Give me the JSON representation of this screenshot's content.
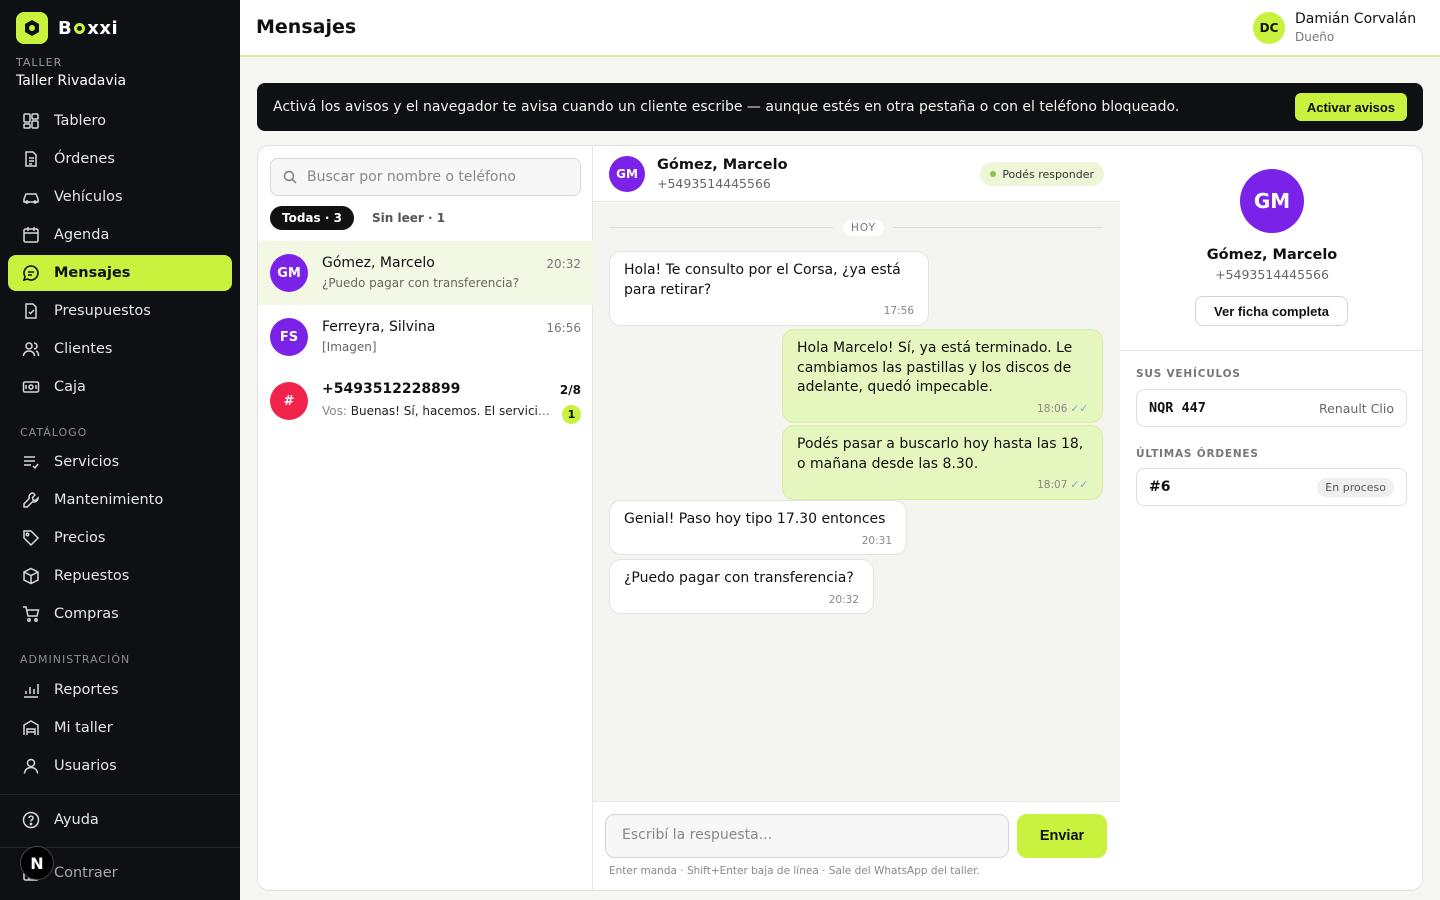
{
  "app": {
    "brand_prefix": "B",
    "brand_suffix": "xxi"
  },
  "workshop": {
    "label": "TALLER",
    "name": "Taller Rivadavia"
  },
  "nav": {
    "main": [
      {
        "label": "Tablero",
        "icon": "dashboard-icon"
      },
      {
        "label": "Órdenes",
        "icon": "document-icon"
      },
      {
        "label": "Vehículos",
        "icon": "car-icon"
      },
      {
        "label": "Agenda",
        "icon": "calendar-icon"
      },
      {
        "label": "Mensajes",
        "icon": "chat-icon",
        "active": true
      },
      {
        "label": "Presupuestos",
        "icon": "quote-icon"
      },
      {
        "label": "Clientes",
        "icon": "users-icon"
      },
      {
        "label": "Caja",
        "icon": "cash-icon"
      }
    ],
    "catalog_label": "CATÁLOGO",
    "catalog": [
      {
        "label": "Servicios",
        "icon": "list-check-icon"
      },
      {
        "label": "Mantenimiento",
        "icon": "wrench-icon"
      },
      {
        "label": "Precios",
        "icon": "tag-icon"
      },
      {
        "label": "Repuestos",
        "icon": "box-icon"
      },
      {
        "label": "Compras",
        "icon": "cart-icon"
      }
    ],
    "admin_label": "ADMINISTRACIÓN",
    "admin": [
      {
        "label": "Reportes",
        "icon": "bar-chart-icon"
      },
      {
        "label": "Mi taller",
        "icon": "warehouse-icon"
      },
      {
        "label": "Usuarios",
        "icon": "user-icon"
      }
    ],
    "help": "Ayuda",
    "collapse": "Contraer",
    "overlay_badge": "N"
  },
  "header": {
    "title": "Mensajes"
  },
  "user": {
    "initials": "DC",
    "name": "Damián Corvalán",
    "role": "Dueño"
  },
  "banner": {
    "text": "Activá los avisos y el navegador te avisa cuando un cliente escribe — aunque estés en otra pestaña o con el teléfono bloqueado.",
    "button": "Activar avisos"
  },
  "list": {
    "search_placeholder": "Buscar por nombre o teléfono",
    "filter_all": "Todas · 3",
    "filter_unread": "Sin leer · 1",
    "conversations": [
      {
        "initials": "GM",
        "name": "Gómez, Marcelo",
        "time": "20:32",
        "preview": "¿Puedo pagar con transferencia?",
        "color": "#7b22e8"
      },
      {
        "initials": "FS",
        "name": "Ferreyra, Silvina",
        "time": "16:56",
        "preview": "[Imagen]",
        "color": "#7b22e8"
      },
      {
        "initials": "#",
        "name": "+5493512228899",
        "time": "2/8",
        "preview_prefix": "Vos: ",
        "preview": "Buenas! Sí, hacemos. El servicio completo",
        "unread": "1",
        "color": "#f0234b"
      }
    ]
  },
  "chat": {
    "initials": "GM",
    "name": "Gómez, Marcelo",
    "phone": "+5493514445566",
    "status": "Podés responder",
    "day_label": "HOY",
    "tick": "✓✓",
    "messages": [
      {
        "dir": "in",
        "text": "Hola! Te consulto por el Corsa, ¿ya está para retirar?",
        "time": "17:56"
      },
      {
        "dir": "out",
        "text": "Hola Marcelo! Sí, ya está terminado. Le cambiamos las pastillas y los discos de adelante, quedó impecable.",
        "time": "18:06"
      },
      {
        "dir": "out",
        "text": "Podés pasar a buscarlo hoy hasta las 18, o mañana desde las 8.30.",
        "time": "18:07"
      },
      {
        "dir": "in",
        "text": "Genial! Paso hoy tipo 17.30 entonces",
        "time": "20:31"
      },
      {
        "dir": "in",
        "text": "¿Puedo pagar con transferencia?",
        "time": "20:32"
      }
    ],
    "composer_placeholder": "Escribí la respuesta...",
    "send_label": "Enviar",
    "hint": "Enter manda · Shift+Enter baja de línea · Sale del WhatsApp del taller."
  },
  "detail": {
    "initials": "GM",
    "name": "Gómez, Marcelo",
    "phone": "+5493514445566",
    "view_button": "Ver ficha completa",
    "vehicles_label": "SUS VEHÍCULOS",
    "vehicle": {
      "plate": "NQR 447",
      "model": "Renault Clio"
    },
    "orders_label": "ÚLTIMAS ÓRDENES",
    "order": {
      "number": "#6",
      "status": "En proceso"
    }
  },
  "colors": {
    "accent": "#c8f23d",
    "sidebar_bg": "#0f1014",
    "avatar_purple": "#7b22e8",
    "avatar_red": "#f0234b"
  }
}
